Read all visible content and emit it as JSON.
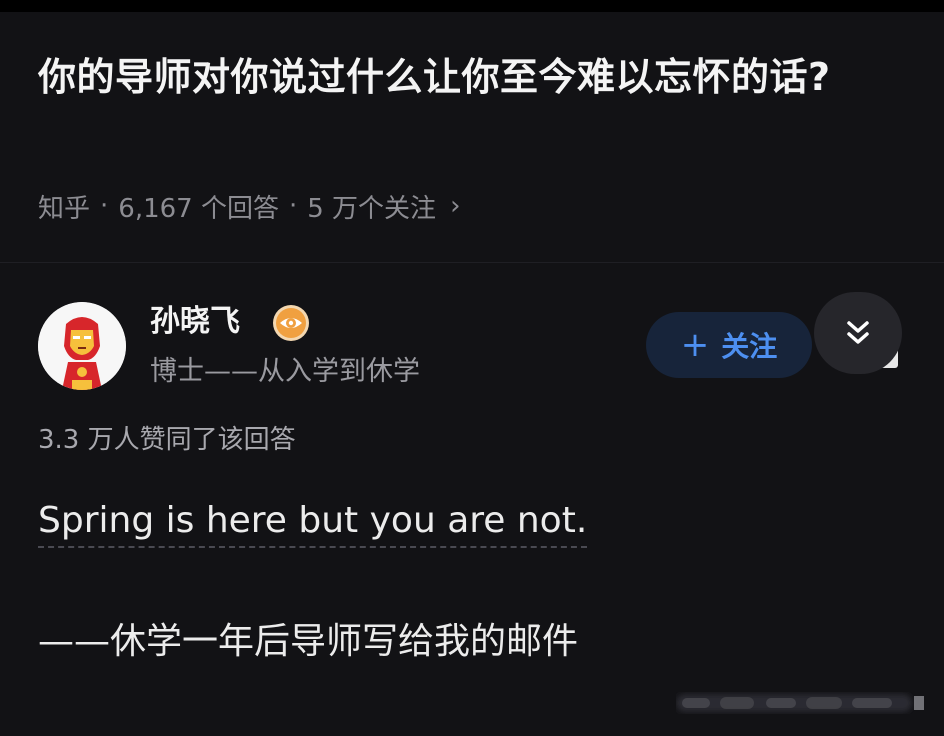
{
  "question": {
    "title": "你的导师对你说过什么让你至今难以忘怀的话?"
  },
  "meta": {
    "source": "知乎",
    "separator": "·",
    "answers": "6,167 个回答",
    "followers": "5 万个关注",
    "chevron_icon": "chevron-right-icon"
  },
  "author": {
    "name": "孙晓飞",
    "headline": "博士——从入学到休学",
    "avatar_icon": "iron-man-avatar",
    "badge_icon": "eye-badge-icon"
  },
  "actions": {
    "follow_plus": "+",
    "follow_label": "关注",
    "collapse_icon": "double-chevron-down-icon"
  },
  "answer": {
    "upvotes": "3.3 万人赞同了该回答",
    "line1": "Spring is here but you are not.",
    "line2": "——休学一年后导师写给我的邮件"
  },
  "colors": {
    "background": "#121215",
    "accent": "#4d8ff0",
    "badge": "#f0a040"
  }
}
